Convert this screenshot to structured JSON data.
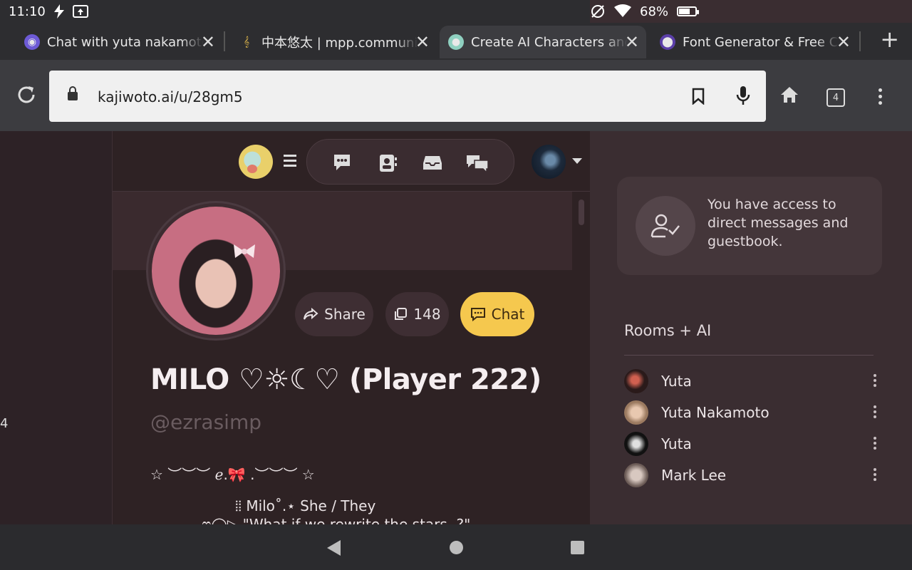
{
  "status": {
    "time": "11:10",
    "battery": "68%",
    "battery_level": 0.68
  },
  "tabs": [
    {
      "title": "Chat with yuta nakamoto on",
      "favicon": "chat-face-icon"
    },
    {
      "title": "中本悠太 | mpp.community",
      "favicon": "music-note-icon"
    },
    {
      "title": "Create AI Characters and Ch",
      "favicon": "dino-icon"
    },
    {
      "title": "Font Generator & Free Custo",
      "favicon": "planet-icon"
    }
  ],
  "toolbar": {
    "url": "kajiwoto.ai/u/28gm5",
    "tab_count": "4"
  },
  "profile": {
    "name": "MILO ♡☼☾♡ (Player 222)",
    "handle": "@ezrasimp",
    "share_label": "Share",
    "copies_count": "148",
    "chat_label": "Chat",
    "bio_line1": "☆ ︶︶︶ ℯ.🎀 .︶︶︶ ☆",
    "bio_line2": "⦙⦙ Milo˚.⋆ She / They",
    "bio_line3": "ෆ◯▷ \"What if we rewrite the stars..?\""
  },
  "leftcol": {
    "edge_text": "4"
  },
  "sidebar": {
    "notice": "You have access to direct messages and guestbook.",
    "rooms_title": "Rooms + AI",
    "rooms": [
      {
        "name": "Yuta",
        "color": "#5a2a2a"
      },
      {
        "name": "Yuta Nakamoto",
        "color": "#c9a58a"
      },
      {
        "name": "Yuta",
        "color": "#2a2a2a"
      },
      {
        "name": "Mark Lee",
        "color": "#a89a90"
      }
    ]
  },
  "colors": {
    "accent": "#f5c84e",
    "background": "#2e2324",
    "panel": "#3a2d31"
  }
}
